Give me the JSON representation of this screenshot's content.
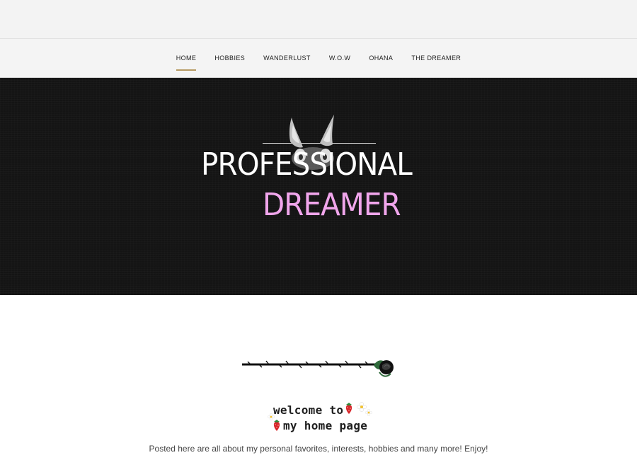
{
  "nav": {
    "items": [
      {
        "label": "HOME",
        "active": true
      },
      {
        "label": "HOBBIES",
        "active": false
      },
      {
        "label": "WANDERLUST",
        "active": false
      },
      {
        "label": "W.O.W",
        "active": false
      },
      {
        "label": "OHANA",
        "active": false
      },
      {
        "label": "THE DREAMER",
        "active": false
      }
    ]
  },
  "hero": {
    "title_line1": "PROFESSIONAL",
    "title_line2": "DREAMER",
    "title_line2_color": "#f1a6ec",
    "background": "#141414"
  },
  "welcome": {
    "line1": "welcome to",
    "line2": "my home page"
  },
  "intro_text": "Posted here are all about my personal favorites, interests, hobbies and many more! Enjoy!",
  "colors": {
    "nav_active_underline": "#b69a63"
  }
}
